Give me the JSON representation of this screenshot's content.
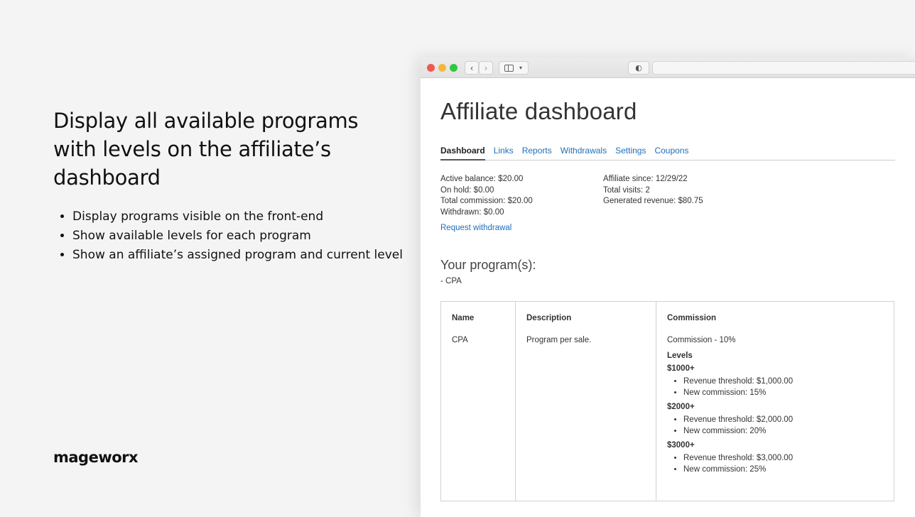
{
  "promo": {
    "title": "Display all available programs with levels on the affiliate’s dashboard",
    "bullets": [
      "Display programs visible on the front-end",
      "Show available levels for each program",
      "Show an affiliate’s assigned program and current level"
    ],
    "brand": "mageworx"
  },
  "browser": {
    "icons": [
      "back-icon",
      "forward-icon",
      "sidebar-icon",
      "shield-icon"
    ]
  },
  "dashboard": {
    "title": "Affiliate dashboard",
    "tabs": [
      "Dashboard",
      "Links",
      "Reports",
      "Withdrawals",
      "Settings",
      "Coupons"
    ],
    "active_tab": "Dashboard",
    "stats_left": [
      "Active balance: $20.00",
      "On hold: $0.00",
      "Total commission: $20.00",
      "Withdrawn: $0.00"
    ],
    "stats_right": [
      "Affiliate since: 12/29/22",
      "Total visits: 2",
      "Generated revenue: $80.75"
    ],
    "request_link": "Request withdrawal",
    "programs_heading": "Your program(s):",
    "programs_item": "- CPA",
    "table": {
      "headers": [
        "Name",
        "Description",
        "Commission"
      ],
      "row": {
        "name": "CPA",
        "description": "Program per sale.",
        "commission": "Commission - 10%",
        "levels_label": "Levels",
        "levels": [
          {
            "name": "$1000+",
            "threshold": "Revenue threshold: $1,000.00",
            "commission": "New commission: 15%"
          },
          {
            "name": "$2000+",
            "threshold": "Revenue threshold: $2,000.00",
            "commission": "New commission: 20%"
          },
          {
            "name": "$3000+",
            "threshold": "Revenue threshold: $3,000.00",
            "commission": "New commission: 25%"
          }
        ]
      }
    }
  },
  "colors": {
    "link": "#1f6fb8",
    "background": "#f4f4f4",
    "dot_red": "#ee5a52",
    "dot_yellow": "#f4b63f",
    "dot_green": "#2fc840"
  }
}
